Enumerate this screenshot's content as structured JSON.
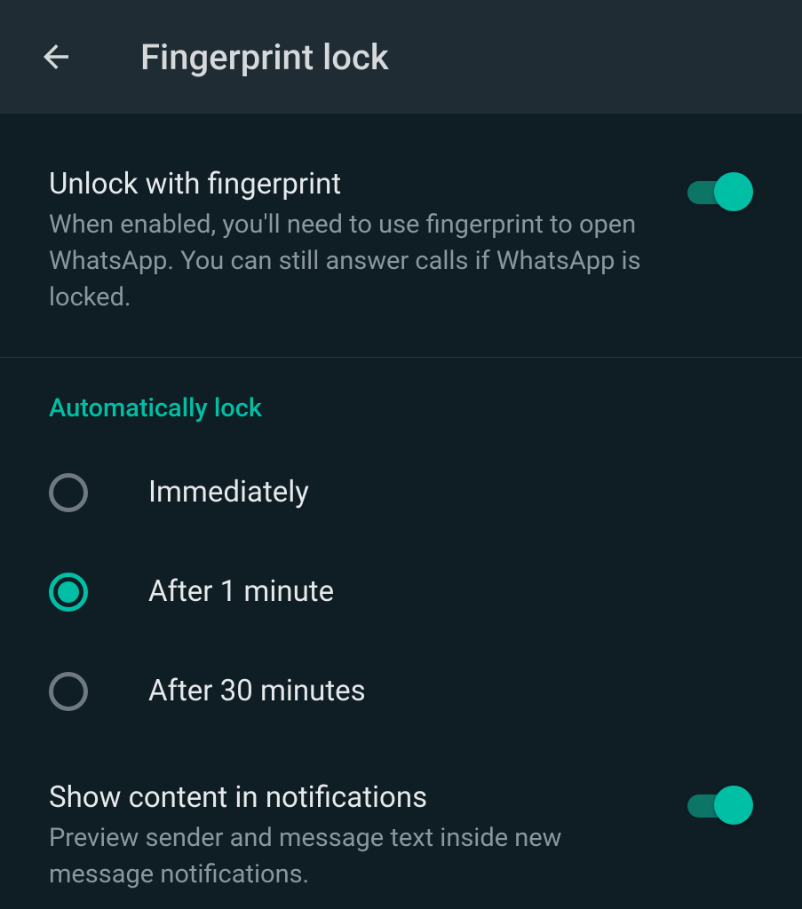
{
  "header": {
    "title": "Fingerprint lock"
  },
  "unlock": {
    "title": "Unlock with fingerprint",
    "desc": "When enabled, you'll need to use fingerprint to open WhatsApp. You can still answer calls if WhatsApp is locked.",
    "enabled": true
  },
  "autoLock": {
    "header": "Automatically lock",
    "options": [
      {
        "label": "Immediately",
        "selected": false
      },
      {
        "label": "After 1 minute",
        "selected": true
      },
      {
        "label": "After 30 minutes",
        "selected": false
      }
    ]
  },
  "showContent": {
    "title": "Show content in notifications",
    "desc": "Preview sender and message text inside new message notifications.",
    "enabled": true
  }
}
